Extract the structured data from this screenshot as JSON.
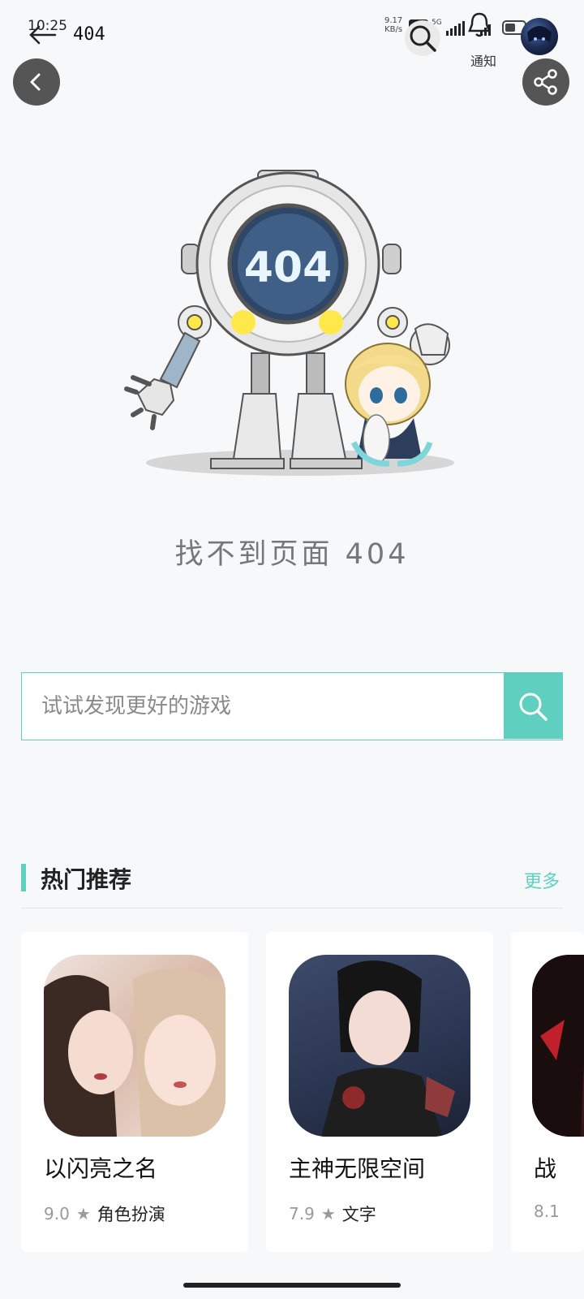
{
  "status": {
    "time": "10:25",
    "net_speed_top": "9.17",
    "net_speed_bottom": "KB/s",
    "hd": "HD",
    "network": "5G"
  },
  "topbar": {
    "title": "404",
    "notify_label": "通知"
  },
  "robot_screen_text": "404",
  "error_message": "找不到页面 404",
  "search": {
    "placeholder": "试试发现更好的游戏"
  },
  "section": {
    "title": "热门推荐",
    "more": "更多"
  },
  "games": [
    {
      "name": "以闪亮之名",
      "score": "9.0",
      "genre": "角色扮演"
    },
    {
      "name": "主神无限空间",
      "score": "7.9",
      "genre": "文字"
    },
    {
      "name": "战",
      "score": "8.1",
      "genre": ""
    }
  ],
  "colors": {
    "accent": "#5fd0c0",
    "background": "#f7f8fa",
    "button_dark": "#555555"
  },
  "icons": [
    "back-arrow-icon",
    "search-icon",
    "bell-icon",
    "chevron-left-icon",
    "share-icon",
    "star-icon"
  ]
}
